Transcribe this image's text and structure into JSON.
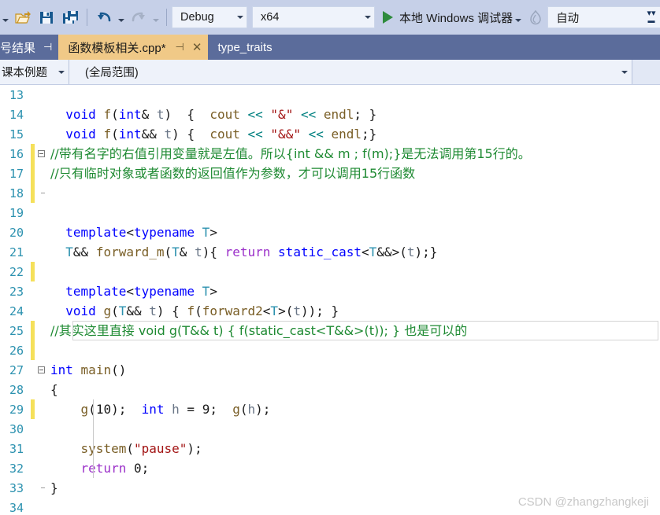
{
  "toolbar": {
    "icons": [
      {
        "name": "open-file-icon",
        "glyph": "open"
      },
      {
        "name": "save-icon",
        "glyph": "save"
      },
      {
        "name": "save-all-icon",
        "glyph": "save-all"
      },
      {
        "name": "undo-icon",
        "glyph": "undo"
      },
      {
        "name": "redo-icon",
        "glyph": "redo"
      }
    ],
    "configuration": "Debug",
    "platform": "x64",
    "run_label": "本地 Windows 调试器",
    "hot_reload_label": "自动",
    "overflow_label": "»"
  },
  "tabstrip": {
    "docked_panel": "号结果",
    "docked_pin": "⊣",
    "tabs": [
      {
        "label": "函数模板相关.cpp*",
        "active": true,
        "pin": "⊣",
        "close": "✕"
      },
      {
        "label": "type_traits",
        "active": false
      }
    ]
  },
  "navbar": {
    "scope": "课本例题",
    "member": "(全局范围)"
  },
  "editor": {
    "watermark": "CSDN @zhangzhangkeji",
    "lines": [
      {
        "num": "13",
        "changed": false,
        "fold": "none",
        "indent": [],
        "tokens": []
      },
      {
        "num": "14",
        "changed": false,
        "fold": "none",
        "indent": [],
        "tokens": [
          {
            "t": "  ",
            "c": "pl"
          },
          {
            "t": "void",
            "c": "k"
          },
          {
            "t": " ",
            "c": "pl"
          },
          {
            "t": "f",
            "c": "fn"
          },
          {
            "t": "(",
            "c": "pl"
          },
          {
            "t": "int",
            "c": "k"
          },
          {
            "t": "& ",
            "c": "pl"
          },
          {
            "t": "t",
            "c": "id"
          },
          {
            "t": ")  { ",
            "c": "pl"
          },
          {
            "t": " cout",
            "c": "fn"
          },
          {
            "t": " ",
            "c": "pl"
          },
          {
            "t": "<<",
            "c": "op"
          },
          {
            "t": " ",
            "c": "pl"
          },
          {
            "t": "\"&\"",
            "c": "str"
          },
          {
            "t": " ",
            "c": "pl"
          },
          {
            "t": "<<",
            "c": "op"
          },
          {
            "t": " ",
            "c": "pl"
          },
          {
            "t": "endl",
            "c": "fn"
          },
          {
            "t": "; }",
            "c": "pl"
          }
        ]
      },
      {
        "num": "15",
        "changed": false,
        "fold": "none",
        "indent": [],
        "tokens": [
          {
            "t": "  ",
            "c": "pl"
          },
          {
            "t": "void",
            "c": "k"
          },
          {
            "t": " ",
            "c": "pl"
          },
          {
            "t": "f",
            "c": "fn"
          },
          {
            "t": "(",
            "c": "pl"
          },
          {
            "t": "int",
            "c": "k"
          },
          {
            "t": "&& ",
            "c": "pl"
          },
          {
            "t": "t",
            "c": "id"
          },
          {
            "t": ") { ",
            "c": "pl"
          },
          {
            "t": " cout",
            "c": "fn"
          },
          {
            "t": " ",
            "c": "pl"
          },
          {
            "t": "<<",
            "c": "op"
          },
          {
            "t": " ",
            "c": "pl"
          },
          {
            "t": "\"&&\"",
            "c": "str"
          },
          {
            "t": " ",
            "c": "pl"
          },
          {
            "t": "<<",
            "c": "op"
          },
          {
            "t": " ",
            "c": "pl"
          },
          {
            "t": "endl",
            "c": "fn"
          },
          {
            "t": ";}",
            "c": "pl"
          }
        ]
      },
      {
        "num": "16",
        "changed": true,
        "fold": "start",
        "indent": [],
        "tokens": [
          {
            "t": "//带有名字的右值引用变量就是左值。所以{int && m ; f(m);}是无法调用第15行的。",
            "c": "cmcn"
          }
        ]
      },
      {
        "num": "17",
        "changed": true,
        "fold": "mid",
        "indent": [],
        "tokens": [
          {
            "t": "//只有临时对象或者函数的返回值作为参数，才可以调用15行函数",
            "c": "cmcn"
          }
        ]
      },
      {
        "num": "18",
        "changed": true,
        "fold": "end",
        "indent": [],
        "tokens": []
      },
      {
        "num": "19",
        "changed": false,
        "fold": "none",
        "indent": [],
        "tokens": []
      },
      {
        "num": "20",
        "changed": false,
        "fold": "none",
        "indent": [],
        "tokens": [
          {
            "t": "  ",
            "c": "pl"
          },
          {
            "t": "template",
            "c": "k"
          },
          {
            "t": "<",
            "c": "pl"
          },
          {
            "t": "typename",
            "c": "k"
          },
          {
            "t": " ",
            "c": "pl"
          },
          {
            "t": "T",
            "c": "ty"
          },
          {
            "t": ">",
            "c": "pl"
          }
        ]
      },
      {
        "num": "21",
        "changed": false,
        "fold": "none",
        "indent": [],
        "tokens": [
          {
            "t": "  ",
            "c": "pl"
          },
          {
            "t": "T",
            "c": "ty"
          },
          {
            "t": "&& ",
            "c": "pl"
          },
          {
            "t": "forward_m",
            "c": "fn"
          },
          {
            "t": "(",
            "c": "pl"
          },
          {
            "t": "T",
            "c": "ty"
          },
          {
            "t": "& ",
            "c": "pl"
          },
          {
            "t": "t",
            "c": "id"
          },
          {
            "t": "){ ",
            "c": "pl"
          },
          {
            "t": "return",
            "c": "kc"
          },
          {
            "t": " ",
            "c": "pl"
          },
          {
            "t": "static_cast",
            "c": "k"
          },
          {
            "t": "<",
            "c": "pl"
          },
          {
            "t": "T",
            "c": "ty"
          },
          {
            "t": "&&>(",
            "c": "pl"
          },
          {
            "t": "t",
            "c": "id"
          },
          {
            "t": ");}",
            "c": "pl"
          }
        ]
      },
      {
        "num": "22",
        "changed": true,
        "fold": "none",
        "indent": [],
        "tokens": []
      },
      {
        "num": "23",
        "changed": false,
        "fold": "none",
        "indent": [],
        "tokens": [
          {
            "t": "  ",
            "c": "pl"
          },
          {
            "t": "template",
            "c": "k"
          },
          {
            "t": "<",
            "c": "pl"
          },
          {
            "t": "typename",
            "c": "k"
          },
          {
            "t": " ",
            "c": "pl"
          },
          {
            "t": "T",
            "c": "ty"
          },
          {
            "t": ">",
            "c": "pl"
          }
        ]
      },
      {
        "num": "24",
        "changed": false,
        "fold": "none",
        "indent": [],
        "tokens": [
          {
            "t": "  ",
            "c": "pl"
          },
          {
            "t": "void",
            "c": "k"
          },
          {
            "t": " ",
            "c": "pl"
          },
          {
            "t": "g",
            "c": "fn"
          },
          {
            "t": "(",
            "c": "pl"
          },
          {
            "t": "T",
            "c": "ty"
          },
          {
            "t": "&& ",
            "c": "pl"
          },
          {
            "t": "t",
            "c": "id"
          },
          {
            "t": ") { ",
            "c": "pl"
          },
          {
            "t": "f",
            "c": "fn"
          },
          {
            "t": "(",
            "c": "pl"
          },
          {
            "t": "forward2",
            "c": "fn"
          },
          {
            "t": "<",
            "c": "pl"
          },
          {
            "t": "T",
            "c": "ty"
          },
          {
            "t": ">(",
            "c": "pl"
          },
          {
            "t": "t",
            "c": "id"
          },
          {
            "t": ")); }",
            "c": "pl"
          }
        ]
      },
      {
        "num": "25",
        "changed": true,
        "fold": "none",
        "current": true,
        "indent": [],
        "tokens": [
          {
            "t": "//其实这里直接 void g(T&& t) { f(static_cast<T&&>(t)); } 也是可以的",
            "c": "cmcn"
          }
        ]
      },
      {
        "num": "26",
        "changed": true,
        "fold": "none",
        "indent": [],
        "tokens": []
      },
      {
        "num": "27",
        "changed": false,
        "fold": "start",
        "indent": [],
        "tokens": [
          {
            "t": "int",
            "c": "k"
          },
          {
            "t": " ",
            "c": "pl"
          },
          {
            "t": "main",
            "c": "fn"
          },
          {
            "t": "()",
            "c": "pl"
          }
        ]
      },
      {
        "num": "28",
        "changed": false,
        "fold": "mid",
        "indent": [],
        "tokens": [
          {
            "t": "{",
            "c": "pl"
          }
        ]
      },
      {
        "num": "29",
        "changed": true,
        "fold": "mid",
        "indent": [
          118
        ],
        "tokens": [
          {
            "t": "    ",
            "c": "pl"
          },
          {
            "t": "g",
            "c": "fn"
          },
          {
            "t": "(",
            "c": "pl"
          },
          {
            "t": "10",
            "c": "num"
          },
          {
            "t": ");  ",
            "c": "pl"
          },
          {
            "t": "int",
            "c": "k"
          },
          {
            "t": " ",
            "c": "pl"
          },
          {
            "t": "h",
            "c": "id"
          },
          {
            "t": " = ",
            "c": "pl"
          },
          {
            "t": "9",
            "c": "num"
          },
          {
            "t": ";  ",
            "c": "pl"
          },
          {
            "t": "g",
            "c": "fn"
          },
          {
            "t": "(",
            "c": "pl"
          },
          {
            "t": "h",
            "c": "id"
          },
          {
            "t": ");",
            "c": "pl"
          }
        ]
      },
      {
        "num": "30",
        "changed": false,
        "fold": "mid",
        "indent": [
          118
        ],
        "tokens": []
      },
      {
        "num": "31",
        "changed": false,
        "fold": "mid",
        "indent": [
          118
        ],
        "tokens": [
          {
            "t": "    ",
            "c": "pl"
          },
          {
            "t": "system",
            "c": "fn"
          },
          {
            "t": "(",
            "c": "pl"
          },
          {
            "t": "\"pause\"",
            "c": "str"
          },
          {
            "t": ");",
            "c": "pl"
          }
        ]
      },
      {
        "num": "32",
        "changed": false,
        "fold": "mid",
        "indent": [
          118
        ],
        "tokens": [
          {
            "t": "    ",
            "c": "pl"
          },
          {
            "t": "return",
            "c": "kc"
          },
          {
            "t": " ",
            "c": "pl"
          },
          {
            "t": "0",
            "c": "num"
          },
          {
            "t": ";",
            "c": "pl"
          }
        ]
      },
      {
        "num": "33",
        "changed": false,
        "fold": "end",
        "indent": [],
        "tokens": [
          {
            "t": "}",
            "c": "pl"
          }
        ]
      },
      {
        "num": "34",
        "changed": false,
        "fold": "none",
        "indent": [],
        "tokens": []
      }
    ]
  },
  "colors": {
    "toolbar_bg": "#c6d0e8",
    "tabstrip_bg": "#5b6c9b",
    "active_tab_bg": "#f0c987",
    "navbar_bg": "#e2e8f5",
    "line_number": "#2b91af",
    "comment": "#1e8a32",
    "keyword": "#0000ff",
    "string": "#a31515",
    "change_bar": "#f5e05a"
  }
}
